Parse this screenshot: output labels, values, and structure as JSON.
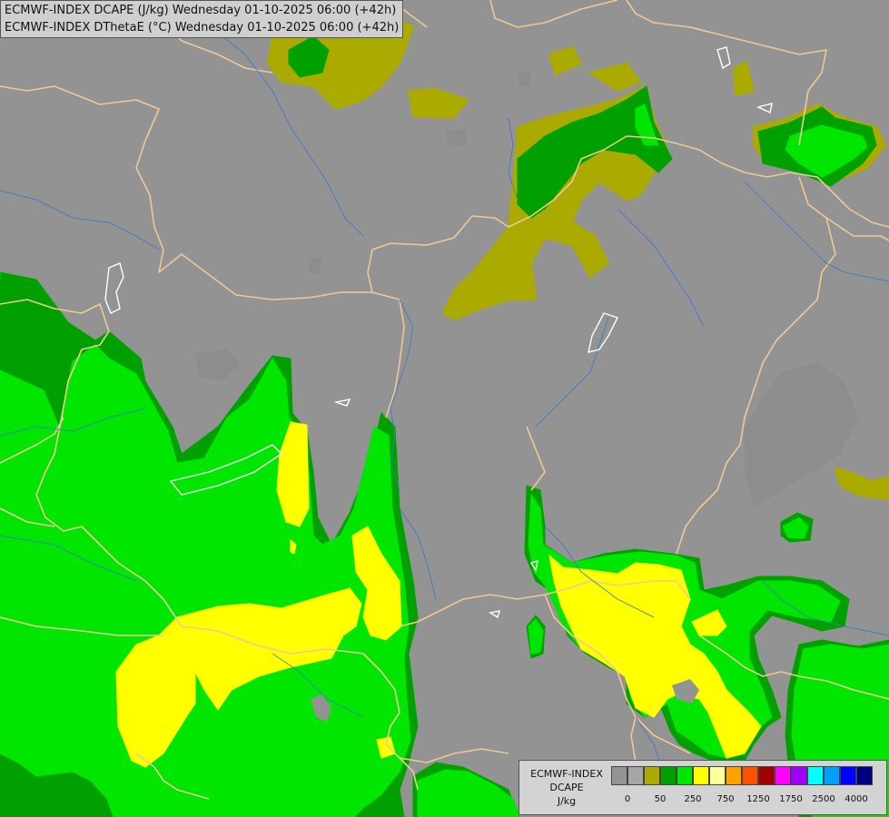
{
  "titles": [
    "ECMWF-INDEX DCAPE (J/kg) Wednesday 01-10-2025 06:00 (+42h)",
    "ECMWF-INDEX DThetaE (°C) Wednesday 01-10-2025 06:00 (+42h)"
  ],
  "legend": {
    "line1": "ECMWF-INDEX",
    "line2": "DCAPE",
    "line3": "J/kg",
    "colors": [
      "#939393",
      "#a6a6a6",
      "#aaaa00",
      "#00a000",
      "#00e600",
      "#ffff00",
      "#ffff99",
      "#ffa000",
      "#ff5000",
      "#a00000",
      "#ff00ff",
      "#a000ff",
      "#00ffff",
      "#00a0ff",
      "#0000ff",
      "#000080"
    ],
    "tick_labels": [
      "0",
      "50",
      "250",
      "750",
      "1250",
      "1750",
      "2500",
      "4000"
    ]
  },
  "colors": {
    "background": "#939393",
    "olive": "#aaaa00",
    "dark_green": "#00a000",
    "green": "#00e600",
    "yellow": "#ffff00",
    "border": "#f0c896",
    "river": "#3c78c8"
  }
}
